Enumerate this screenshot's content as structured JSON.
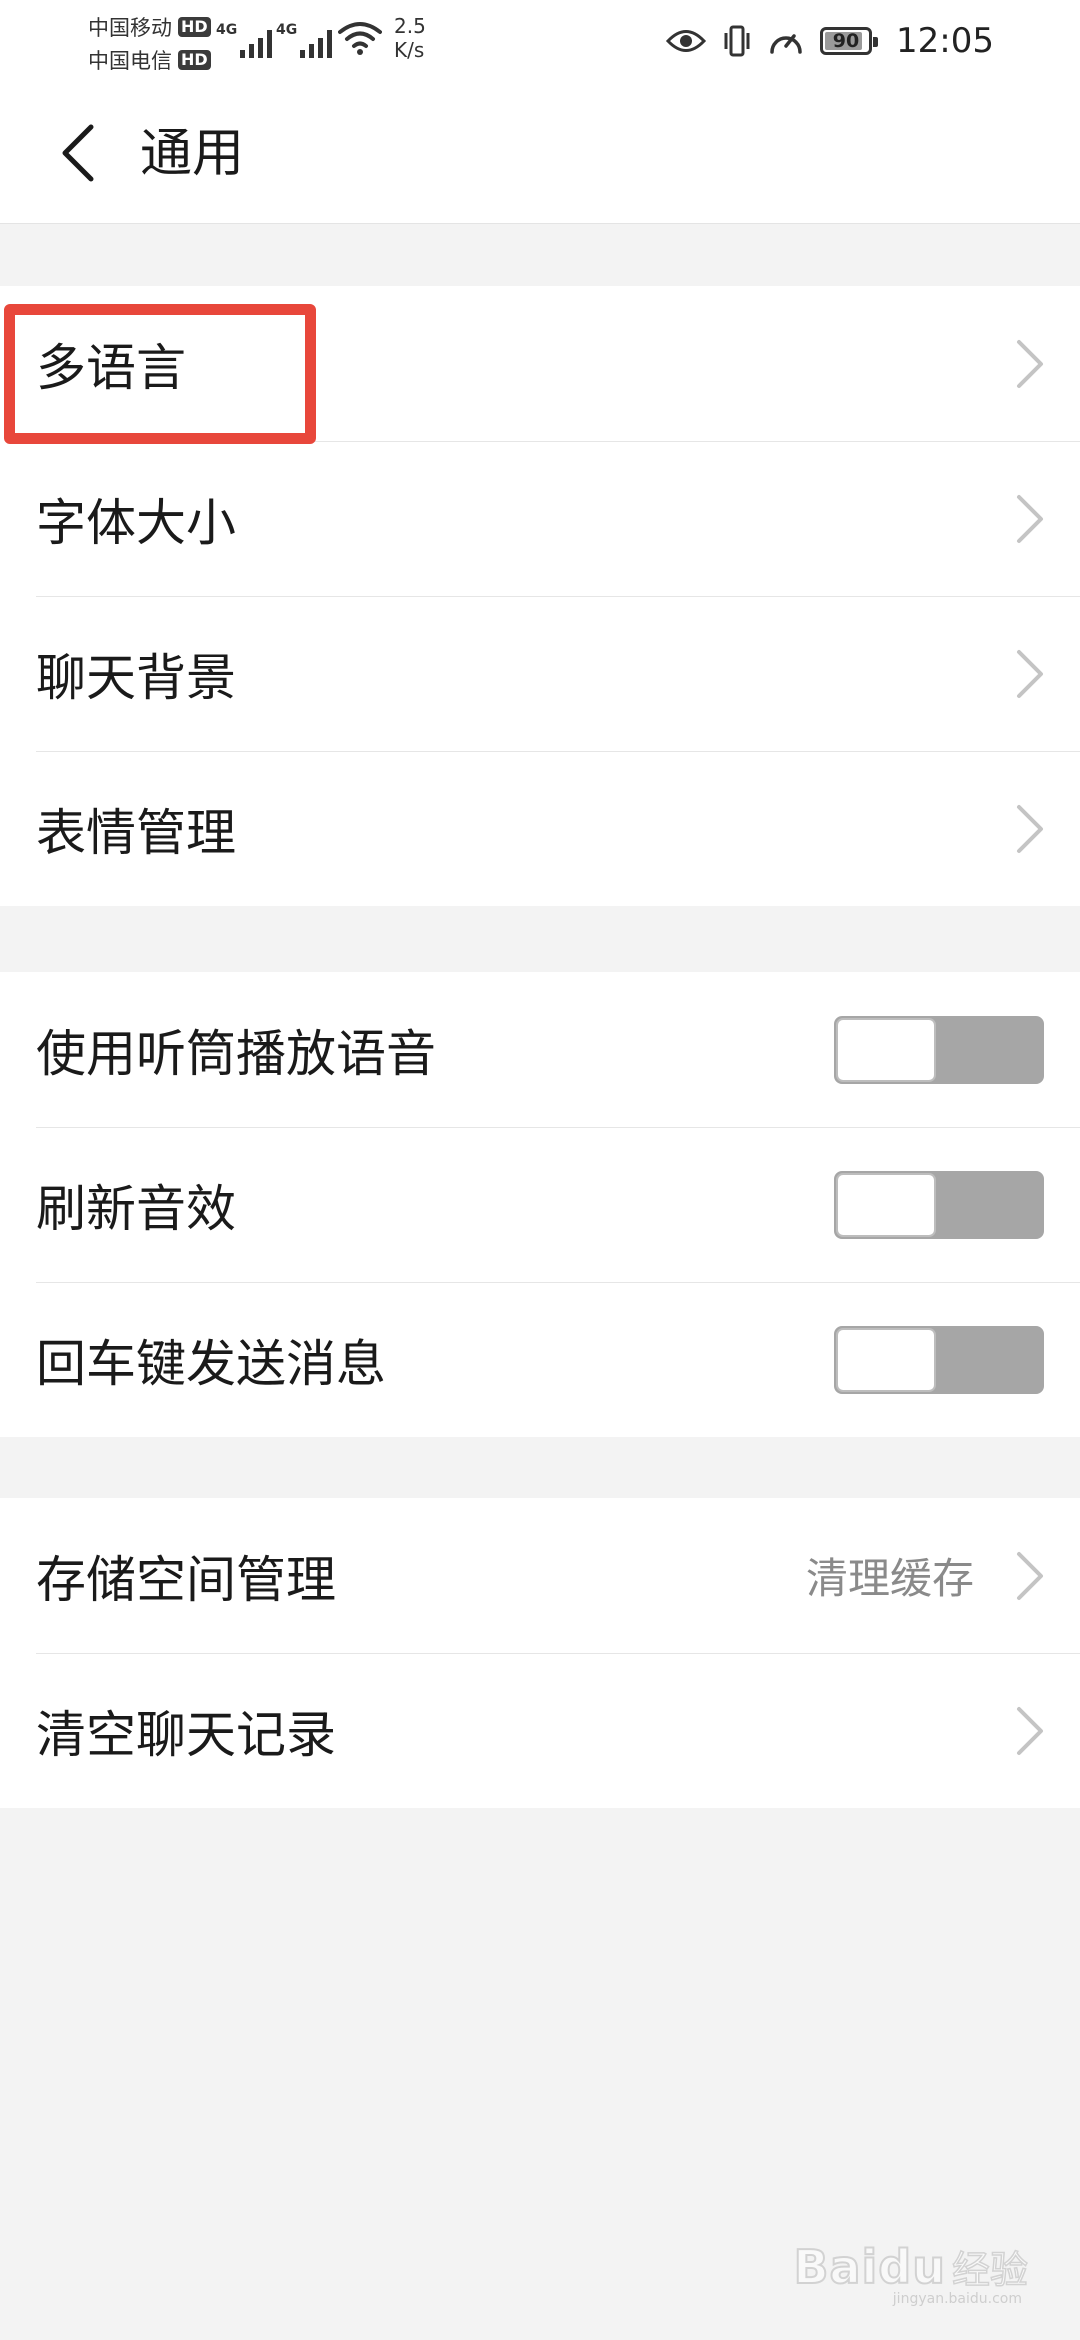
{
  "status_bar": {
    "carrier_1": "中国移动",
    "carrier_2": "中国电信",
    "hd_badge": "HD",
    "network_type": "4G",
    "speed_value": "2.5",
    "speed_unit": "K/s",
    "battery_level": "90",
    "battery_fraction": 0.9,
    "time": "12:05",
    "icons": [
      "signal-icon",
      "wifi-icon",
      "eye-icon",
      "vibrate-icon",
      "speedometer-icon",
      "battery-icon"
    ]
  },
  "header": {
    "title": "通用",
    "back_icon": "chevron-left-icon"
  },
  "group_1": {
    "items": [
      {
        "label": "多语言"
      },
      {
        "label": "字体大小"
      },
      {
        "label": "聊天背景"
      },
      {
        "label": "表情管理"
      }
    ]
  },
  "group_2": {
    "items": [
      {
        "label": "使用听筒播放语音",
        "on": false
      },
      {
        "label": "刷新音效",
        "on": false
      },
      {
        "label": "回车键发送消息",
        "on": false
      }
    ]
  },
  "group_3": {
    "items": [
      {
        "label": "存储空间管理",
        "value": "清理缓存"
      },
      {
        "label": "清空聊天记录"
      }
    ]
  },
  "colors": {
    "background": "#f3f3f3",
    "highlight": "#e8473b",
    "toggle_off": "#a6a6a6"
  },
  "watermark": {
    "brand": "Baidu",
    "sub": "经验",
    "url": "jingyan.baidu.com"
  }
}
